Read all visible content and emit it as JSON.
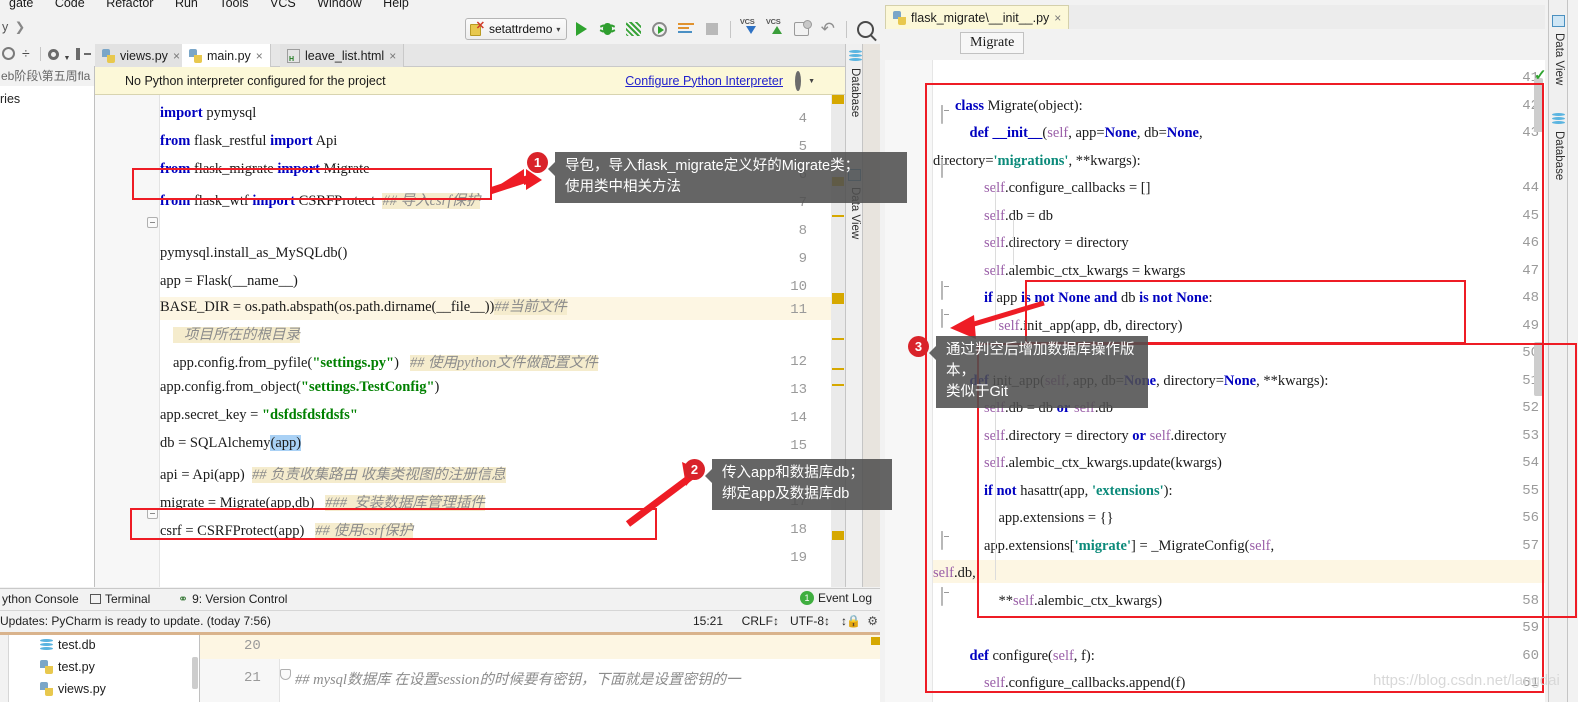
{
  "app": {
    "name": "PyCharm",
    "watermark": "https://blog.csdn.net/langdai"
  },
  "menubar": {
    "items": [
      "gate",
      "Code",
      "Refactor",
      "Run",
      "Tools",
      "VCS",
      "Window",
      "Help"
    ]
  },
  "breadcrumb": {
    "text": "y",
    "chevron": "❯"
  },
  "toolbar": {
    "run_config": "setattrdemo",
    "run_config_caret": "▾",
    "buttons": [
      {
        "name": "run-button",
        "icon": "play-icon"
      },
      {
        "name": "debug-button",
        "icon": "bug-icon"
      },
      {
        "name": "run-coverage-button",
        "icon": "coverage-icon"
      },
      {
        "name": "profile-button",
        "icon": "profile-icon"
      },
      {
        "name": "console-button",
        "icon": "console-icon"
      },
      {
        "name": "stop-button",
        "icon": "stop-icon"
      },
      {
        "name": "vcs-update-button",
        "icon": "vcs-down-icon",
        "label": "VCS"
      },
      {
        "name": "vcs-commit-button",
        "icon": "vcs-up-icon",
        "label": "VCS"
      },
      {
        "name": "vcs-diff-button",
        "icon": "diff-icon"
      },
      {
        "name": "rollback-button",
        "icon": "undo-icon"
      },
      {
        "name": "search-everywhere-button",
        "icon": "search-icon"
      }
    ]
  },
  "project_panel": {
    "path": "eb阶段\\第五周fla",
    "items": [
      "ries"
    ]
  },
  "editor_tabs": [
    {
      "label": "views.py",
      "icon": "python-file-icon",
      "selected": false,
      "close": "×"
    },
    {
      "label": "main.py",
      "icon": "python-file-icon",
      "selected": true,
      "close": "×"
    },
    {
      "label": "leave_list.html",
      "icon": "html-file-icon",
      "selected": false,
      "close": "×"
    }
  ],
  "notification": {
    "message": "No Python interpreter configured for the project",
    "link": "Configure Python Interpreter",
    "gear": "gear-icon"
  },
  "left_editor": {
    "file": "main.py",
    "lines": [
      {
        "n": "4",
        "segments": [
          {
            "t": "import",
            "c": "kw"
          },
          {
            "t": " pymysql",
            "c": ""
          }
        ]
      },
      {
        "n": "5",
        "segments": [
          {
            "t": "from",
            "c": "kw"
          },
          {
            "t": " flask_restful ",
            "c": ""
          },
          {
            "t": "import",
            "c": "kw"
          },
          {
            "t": " Api",
            "c": ""
          }
        ]
      },
      {
        "n": "6",
        "segments": [
          {
            "t": "from",
            "c": "kw"
          },
          {
            "t": " flask_migrate ",
            "c": ""
          },
          {
            "t": "import",
            "c": "kw"
          },
          {
            "t": " Migrate",
            "c": ""
          }
        ]
      },
      {
        "n": "7",
        "segments": [
          {
            "t": "from",
            "c": "kw"
          },
          {
            "t": " flask_wtf ",
            "c": ""
          },
          {
            "t": "import",
            "c": "kw"
          },
          {
            "t": " CSRFProtect  ",
            "c": ""
          },
          {
            "t": "## 导入csrf保护",
            "c": "cmt"
          }
        ]
      },
      {
        "n": "8",
        "segments": []
      },
      {
        "n": "9",
        "segments": [
          {
            "t": "pymysql.install_as_MySQLdb()",
            "c": ""
          }
        ]
      },
      {
        "n": "10",
        "segments": [
          {
            "t": "app = Flask(__name__)",
            "c": ""
          }
        ]
      },
      {
        "n": "11",
        "segments": [
          {
            "t": "BASE_DIR = os.path.abspath(os.path.dirname(__file__))",
            "c": ""
          },
          {
            "t": "##当前文件",
            "c": "cmt"
          }
        ]
      },
      {
        "n": "11b",
        "segments": [
          {
            "t": "   项目所在的根目录",
            "c": "cmt"
          }
        ]
      },
      {
        "n": "12",
        "segments": [
          {
            "t": "app.config.from_pyfile(",
            "c": ""
          },
          {
            "t": "\"settings.py\"",
            "c": "str"
          },
          {
            "t": ")   ",
            "c": ""
          },
          {
            "t": "## 使用python文件做配置文件",
            "c": "cmt"
          }
        ]
      },
      {
        "n": "13",
        "segments": [
          {
            "t": "app.config.from_object(",
            "c": ""
          },
          {
            "t": "\"settings.TestConfig\"",
            "c": "str"
          },
          {
            "t": ")",
            "c": ""
          }
        ]
      },
      {
        "n": "14",
        "segments": [
          {
            "t": "app.secret_key = ",
            "c": ""
          },
          {
            "t": "\"dsfdsfdsfdsfs\"",
            "c": "str"
          }
        ]
      },
      {
        "n": "15",
        "segments": [
          {
            "t": "db = SQLAlchemy",
            "c": ""
          },
          {
            "t": "(app)",
            "c": "sel"
          }
        ]
      },
      {
        "n": "16",
        "segments": [
          {
            "t": "api = Api(app)  ",
            "c": ""
          },
          {
            "t": "## 负责收集路由 收集类视图的注册信息",
            "c": "cmt"
          }
        ]
      },
      {
        "n": "17",
        "segments": [
          {
            "t": "migrate = Migrate(app,db)   ",
            "c": ""
          },
          {
            "t": "###  安装数据库管理插件",
            "c": "cmt"
          }
        ]
      },
      {
        "n": "18",
        "segments": [
          {
            "t": "csrf = CSRFProtect(app)   ",
            "c": ""
          },
          {
            "t": "## 使用csrf保护",
            "c": "cmt"
          }
        ]
      },
      {
        "n": "19",
        "segments": []
      }
    ]
  },
  "right_window": {
    "tab": {
      "label": "flask_migrate\\__init__.py",
      "icon": "python-file-icon",
      "close": "×"
    },
    "breadcrumb": "Migrate",
    "lines": [
      {
        "n": "41",
        "segments": []
      },
      {
        "n": "42",
        "segments": [
          {
            "t": "class",
            "c": "kw"
          },
          {
            "t": " Migrate(",
            "c": ""
          },
          {
            "t": "object",
            "c": ""
          },
          {
            "t": "):",
            "c": ""
          }
        ]
      },
      {
        "n": "43",
        "segments": [
          {
            "t": "    ",
            "c": ""
          },
          {
            "t": "def",
            "c": "kw"
          },
          {
            "t": " ",
            "c": ""
          },
          {
            "t": "__init__",
            "c": "kw"
          },
          {
            "t": "(",
            "c": ""
          },
          {
            "t": "self",
            "c": "sf"
          },
          {
            "t": ", app=",
            "c": ""
          },
          {
            "t": "None",
            "c": "kw"
          },
          {
            "t": ", db=",
            "c": ""
          },
          {
            "t": "None",
            "c": "kw"
          },
          {
            "t": ",",
            "c": ""
          }
        ]
      },
      {
        "n": "43b",
        "segments": [
          {
            "t": "directory=",
            "c": ""
          },
          {
            "t": "'migrations'",
            "c": "tq"
          },
          {
            "t": ", **kwargs):",
            "c": ""
          }
        ]
      },
      {
        "n": "44",
        "segments": [
          {
            "t": "        ",
            "c": ""
          },
          {
            "t": "self",
            "c": "sf"
          },
          {
            "t": ".configure_callbacks = []",
            "c": ""
          }
        ]
      },
      {
        "n": "45",
        "segments": [
          {
            "t": "        ",
            "c": ""
          },
          {
            "t": "self",
            "c": "sf"
          },
          {
            "t": ".db = db",
            "c": ""
          }
        ]
      },
      {
        "n": "46",
        "segments": [
          {
            "t": "        ",
            "c": ""
          },
          {
            "t": "self",
            "c": "sf"
          },
          {
            "t": ".directory = directory",
            "c": ""
          }
        ]
      },
      {
        "n": "47",
        "segments": [
          {
            "t": "        ",
            "c": ""
          },
          {
            "t": "self",
            "c": "sf"
          },
          {
            "t": ".alembic_ctx_kwargs = kwargs",
            "c": ""
          }
        ]
      },
      {
        "n": "48",
        "segments": [
          {
            "t": "        ",
            "c": ""
          },
          {
            "t": "if",
            "c": "kw"
          },
          {
            "t": " app ",
            "c": ""
          },
          {
            "t": "is",
            "c": "kw"
          },
          {
            "t": " ",
            "c": ""
          },
          {
            "t": "not",
            "c": "kw"
          },
          {
            "t": " ",
            "c": ""
          },
          {
            "t": "None",
            "c": "kw"
          },
          {
            "t": " ",
            "c": ""
          },
          {
            "t": "and",
            "c": "kw"
          },
          {
            "t": " db ",
            "c": ""
          },
          {
            "t": "is",
            "c": "kw"
          },
          {
            "t": " ",
            "c": ""
          },
          {
            "t": "not",
            "c": "kw"
          },
          {
            "t": " ",
            "c": ""
          },
          {
            "t": "None",
            "c": "kw"
          },
          {
            "t": ":",
            "c": ""
          }
        ]
      },
      {
        "n": "49",
        "segments": [
          {
            "t": "            ",
            "c": ""
          },
          {
            "t": "self",
            "c": "sf"
          },
          {
            "t": ".init_app(app, db, directory)",
            "c": ""
          }
        ]
      },
      {
        "n": "50",
        "segments": []
      },
      {
        "n": "51",
        "segments": [
          {
            "t": "    ",
            "c": ""
          },
          {
            "t": "def",
            "c": "kw"
          },
          {
            "t": " init_app(",
            "c": ""
          },
          {
            "t": "self",
            "c": "sf"
          },
          {
            "t": ", app, db=",
            "c": ""
          },
          {
            "t": "None",
            "c": "kw"
          },
          {
            "t": ", directory=",
            "c": ""
          },
          {
            "t": "None",
            "c": "kw"
          },
          {
            "t": ", **kwargs):",
            "c": ""
          }
        ]
      },
      {
        "n": "52",
        "segments": [
          {
            "t": "        ",
            "c": ""
          },
          {
            "t": "self",
            "c": "sf"
          },
          {
            "t": ".db = db ",
            "c": ""
          },
          {
            "t": "or",
            "c": "kw"
          },
          {
            "t": " ",
            "c": ""
          },
          {
            "t": "self",
            "c": "sf"
          },
          {
            "t": ".db",
            "c": ""
          }
        ]
      },
      {
        "n": "53",
        "segments": [
          {
            "t": "        ",
            "c": ""
          },
          {
            "t": "self",
            "c": "sf"
          },
          {
            "t": ".directory = directory ",
            "c": ""
          },
          {
            "t": "or",
            "c": "kw"
          },
          {
            "t": " ",
            "c": ""
          },
          {
            "t": "self",
            "c": "sf"
          },
          {
            "t": ".directory",
            "c": ""
          }
        ]
      },
      {
        "n": "54",
        "segments": [
          {
            "t": "        ",
            "c": ""
          },
          {
            "t": "self",
            "c": "sf"
          },
          {
            "t": ".alembic_ctx_kwargs.update(kwargs)",
            "c": ""
          }
        ]
      },
      {
        "n": "55",
        "segments": [
          {
            "t": "        ",
            "c": ""
          },
          {
            "t": "if",
            "c": "kw"
          },
          {
            "t": " ",
            "c": ""
          },
          {
            "t": "not",
            "c": "kw"
          },
          {
            "t": " hasattr(app, ",
            "c": ""
          },
          {
            "t": "'extensions'",
            "c": "tq"
          },
          {
            "t": "):",
            "c": ""
          }
        ]
      },
      {
        "n": "56",
        "segments": [
          {
            "t": "            app.extensions = {}",
            "c": ""
          }
        ]
      },
      {
        "n": "57",
        "segments": [
          {
            "t": "        app.extensions[",
            "c": ""
          },
          {
            "t": "'migrate'",
            "c": "tq"
          },
          {
            "t": "] = _MigrateConfig(",
            "c": ""
          },
          {
            "t": "self",
            "c": "sf"
          },
          {
            "t": ",",
            "c": ""
          }
        ]
      },
      {
        "n": "57b",
        "segments": [
          {
            "t": "self",
            "c": "sf"
          },
          {
            "t": ".db,",
            "c": ""
          }
        ]
      },
      {
        "n": "58",
        "segments": [
          {
            "t": "            **",
            "c": ""
          },
          {
            "t": "self",
            "c": "sf"
          },
          {
            "t": ".alembic_ctx_kwargs)",
            "c": ""
          }
        ]
      },
      {
        "n": "59",
        "segments": []
      },
      {
        "n": "60",
        "segments": [
          {
            "t": "    ",
            "c": ""
          },
          {
            "t": "def",
            "c": "kw"
          },
          {
            "t": " configure(",
            "c": ""
          },
          {
            "t": "self",
            "c": "sf"
          },
          {
            "t": ", f):",
            "c": ""
          }
        ]
      },
      {
        "n": "61",
        "segments": [
          {
            "t": "        ",
            "c": ""
          },
          {
            "t": "self",
            "c": "sf"
          },
          {
            "t": ".configure_callbacks.append(f)",
            "c": ""
          }
        ]
      }
    ]
  },
  "annotations": [
    {
      "id": "1",
      "badge": "1",
      "text": "导包，导入flask_migrate定义好的Migrate类；\n使用类中相关方法"
    },
    {
      "id": "2",
      "badge": "2",
      "text": "传入app和数据库db；\n绑定app及数据库db"
    },
    {
      "id": "3",
      "badge": "3",
      "text": "通过判空后增加数据库操作版本，\n类似于Git"
    }
  ],
  "bottom_toolwindows": [
    {
      "label": "ython Console",
      "icon": "python-console-icon"
    },
    {
      "label": "Terminal",
      "icon": "terminal-icon"
    },
    {
      "label": "9: Version Control",
      "icon": "vcs-branch-icon",
      "underline": "9"
    }
  ],
  "event_log": {
    "label": "Event Log",
    "count": "1"
  },
  "status_bar": {
    "message": "Updates: PyCharm is ready to update. (today 7:56)",
    "caret": "15:21",
    "line_sep": "CRLF↕",
    "encoding": "UTF-8↕",
    "indent": "↕",
    "lock": "lock-icon",
    "python": "interpreter-icon"
  },
  "bottom_tree": [
    {
      "label": "test.db",
      "icon": "database-file-icon"
    },
    {
      "label": "test.py",
      "icon": "python-file-icon"
    },
    {
      "label": "views.py",
      "icon": "python-file-icon"
    }
  ],
  "bottom_editor": {
    "lines": [
      {
        "n": "20",
        "text": ""
      },
      {
        "n": "21",
        "text": "## mysql数据库 在设置session的时候要有密钥，下面就是设置密钥的一"
      }
    ]
  },
  "sidebars": {
    "left_inner": [
      {
        "label": "Database",
        "icon": "database-icon"
      },
      {
        "label": "Data View",
        "icon": "data-view-icon"
      }
    ],
    "right_outer": [
      {
        "label": "Data View",
        "icon": "data-view-icon"
      },
      {
        "label": "Database",
        "icon": "database-icon"
      }
    ]
  },
  "colors": {
    "annotation_red": "#ee1c25",
    "badge_red": "#d9232a",
    "tooltip_bg": "rgba(80,80,80,0.88)",
    "notification_bg": "#fcf8d8",
    "comment": "#8c8c8c",
    "keyword": "#0000c0",
    "string": "#008000"
  }
}
